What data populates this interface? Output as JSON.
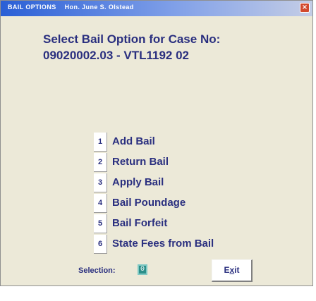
{
  "window": {
    "title_left": "BAIL OPTIONS",
    "title_right": "Hon. June S. Olstead",
    "close_symbol": "×"
  },
  "header": {
    "line1": "Select Bail Option for Case No:",
    "line2": "09020002.03 - VTL1192 02"
  },
  "options": [
    {
      "key": "1",
      "label": "Add Bail"
    },
    {
      "key": "2",
      "label": "Return Bail"
    },
    {
      "key": "3",
      "label": "Apply Bail"
    },
    {
      "key": "4",
      "label": "Bail Poundage"
    },
    {
      "key": "5",
      "label": "Bail Forfeit"
    },
    {
      "key": "6",
      "label": "State Fees from Bail"
    }
  ],
  "selection": {
    "label": "Selection:",
    "value": "0"
  },
  "exit_button": {
    "prefix": "E",
    "mnemonic": "x",
    "suffix": "it"
  },
  "colors": {
    "window_bg": "#ece9d8",
    "text": "#2a2f7f",
    "selection_field": "#2c8f8a"
  }
}
